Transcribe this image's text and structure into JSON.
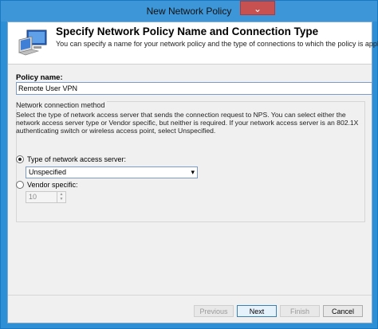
{
  "window": {
    "title": "New Network Policy",
    "close_glyph": "⌄"
  },
  "header": {
    "title": "Specify Network Policy Name and Connection Type",
    "subtitle": "You can specify a name for your network policy and the type of connections to which the policy is applied.",
    "icon": "computer-icon"
  },
  "policy": {
    "label": "Policy name:",
    "value": "Remote User VPN"
  },
  "connection": {
    "group_label": "Network connection method",
    "description": "Select the type of network access server that sends the connection request to NPS. You can select either the network access server type or Vendor specific, but neither is required.  If your network access server is an 802.1X authenticating switch or wireless access point, select Unspecified.",
    "type_label": "Type of network access server:",
    "type_selected": true,
    "type_value": "Unspecified",
    "vendor_label": "Vendor specific:",
    "vendor_selected": false,
    "vendor_value": "10"
  },
  "buttons": {
    "previous": "Previous",
    "next": "Next",
    "finish": "Finish",
    "cancel": "Cancel"
  }
}
